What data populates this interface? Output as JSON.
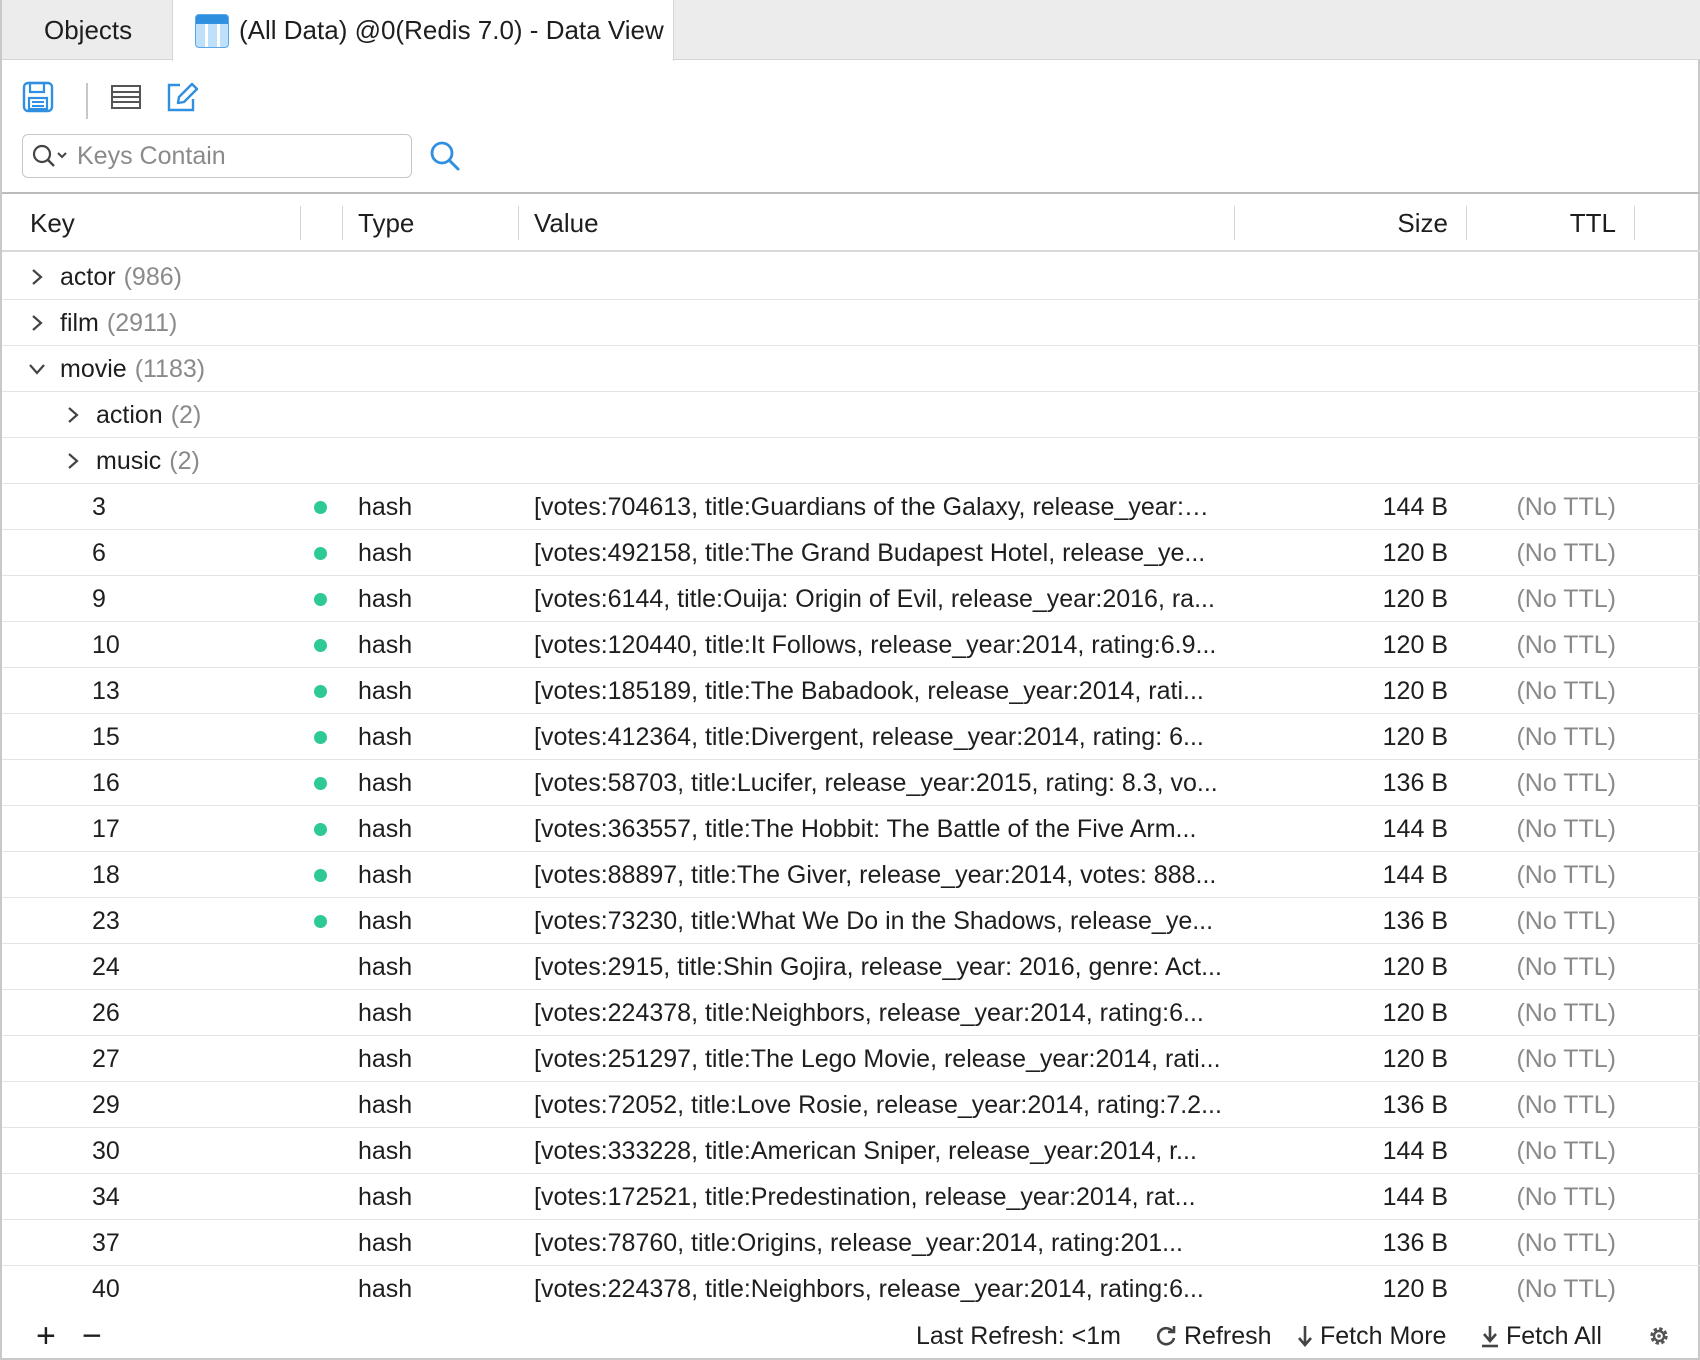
{
  "tabs": {
    "objects_label": "Objects",
    "active_label": "(All Data) @0(Redis 7.0) - Data View"
  },
  "toolbar": {
    "save_icon": "save-icon",
    "list_icon": "list-icon",
    "edit_icon": "edit-icon"
  },
  "search": {
    "placeholder": "Keys Contain",
    "value": ""
  },
  "columns": {
    "key": "Key",
    "type": "Type",
    "value": "Value",
    "size": "Size",
    "ttl": "TTL"
  },
  "groups": [
    {
      "name": "actor",
      "count": "(986)",
      "expanded": false,
      "level": 0
    },
    {
      "name": "film",
      "count": "(2911)",
      "expanded": false,
      "level": 0
    },
    {
      "name": "movie",
      "count": "(1183)",
      "expanded": true,
      "level": 0
    },
    {
      "name": "action",
      "count": "(2)",
      "expanded": false,
      "level": 1
    },
    {
      "name": "music",
      "count": "(2)",
      "expanded": false,
      "level": 1
    }
  ],
  "rows": [
    {
      "key": "3",
      "dot": true,
      "type": "hash",
      "value": "[votes:704613, title:Guardians of the Galaxy, release_year:…",
      "size": "144 B",
      "ttl": "(No TTL)"
    },
    {
      "key": "6",
      "dot": true,
      "type": "hash",
      "value": "[votes:492158, title:The Grand Budapest Hotel, release_ye...",
      "size": "120 B",
      "ttl": "(No TTL)"
    },
    {
      "key": "9",
      "dot": true,
      "type": "hash",
      "value": "[votes:6144, title:Ouija: Origin of Evil, release_year:2016, ra...",
      "size": "120 B",
      "ttl": "(No TTL)"
    },
    {
      "key": "10",
      "dot": true,
      "type": "hash",
      "value": "[votes:120440, title:It Follows, release_year:2014, rating:6.9...",
      "size": "120 B",
      "ttl": "(No TTL)"
    },
    {
      "key": "13",
      "dot": true,
      "type": "hash",
      "value": "[votes:185189, title:The Babadook, release_year:2014, rati...",
      "size": "120 B",
      "ttl": "(No TTL)"
    },
    {
      "key": "15",
      "dot": true,
      "type": "hash",
      "value": "[votes:412364, title:Divergent, release_year:2014, rating: 6...",
      "size": "120 B",
      "ttl": "(No TTL)"
    },
    {
      "key": "16",
      "dot": true,
      "type": "hash",
      "value": "[votes:58703, title:Lucifer, release_year:2015, rating: 8.3, vo...",
      "size": "136 B",
      "ttl": "(No TTL)"
    },
    {
      "key": "17",
      "dot": true,
      "type": "hash",
      "value": "[votes:363557, title:The Hobbit: The Battle of the Five Arm...",
      "size": "144 B",
      "ttl": "(No TTL)"
    },
    {
      "key": "18",
      "dot": true,
      "type": "hash",
      "value": "[votes:88897, title:The Giver, release_year:2014, votes: 888...",
      "size": "144 B",
      "ttl": "(No TTL)"
    },
    {
      "key": "23",
      "dot": true,
      "type": "hash",
      "value": "[votes:73230, title:What We Do in the Shadows, release_ye...",
      "size": "136 B",
      "ttl": "(No TTL)"
    },
    {
      "key": "24",
      "dot": false,
      "type": "hash",
      "value": "[votes:2915, title:Shin Gojira, release_year: 2016, genre: Act...",
      "size": "120 B",
      "ttl": "(No TTL)"
    },
    {
      "key": "26",
      "dot": false,
      "type": "hash",
      "value": "[votes:224378, title:Neighbors, release_year:2014, rating:6...",
      "size": "120 B",
      "ttl": "(No TTL)"
    },
    {
      "key": "27",
      "dot": false,
      "type": "hash",
      "value": "[votes:251297, title:The Lego Movie, release_year:2014, rati...",
      "size": "120 B",
      "ttl": "(No TTL)"
    },
    {
      "key": "29",
      "dot": false,
      "type": "hash",
      "value": "[votes:72052, title:Love Rosie, release_year:2014, rating:7.2...",
      "size": "136 B",
      "ttl": "(No TTL)"
    },
    {
      "key": "30",
      "dot": false,
      "type": "hash",
      "value": "[votes:333228, title:American Sniper, release_year:2014, r...",
      "size": "144 B",
      "ttl": "(No TTL)"
    },
    {
      "key": "34",
      "dot": false,
      "type": "hash",
      "value": "[votes:172521, title:Predestination, release_year:2014, rat...",
      "size": "144 B",
      "ttl": "(No TTL)"
    },
    {
      "key": "37",
      "dot": false,
      "type": "hash",
      "value": "[votes:78760, title:Origins, release_year:2014, rating:201...",
      "size": "136 B",
      "ttl": "(No TTL)"
    },
    {
      "key": "40",
      "dot": false,
      "type": "hash",
      "value": "[votes:224378, title:Neighbors, release_year:2014, rating:6...",
      "size": "120 B",
      "ttl": "(No TTL)"
    }
  ],
  "statusbar": {
    "add_label": "+",
    "remove_label": "−",
    "last_refresh": "Last Refresh: <1m",
    "refresh_label": "Refresh",
    "fetch_more_label": "Fetch More",
    "fetch_all_label": "Fetch All",
    "settings_icon": "gear-icon"
  },
  "colors": {
    "accent": "#2f8fe0",
    "dot": "#2ec995",
    "muted": "#8a8a8a"
  }
}
